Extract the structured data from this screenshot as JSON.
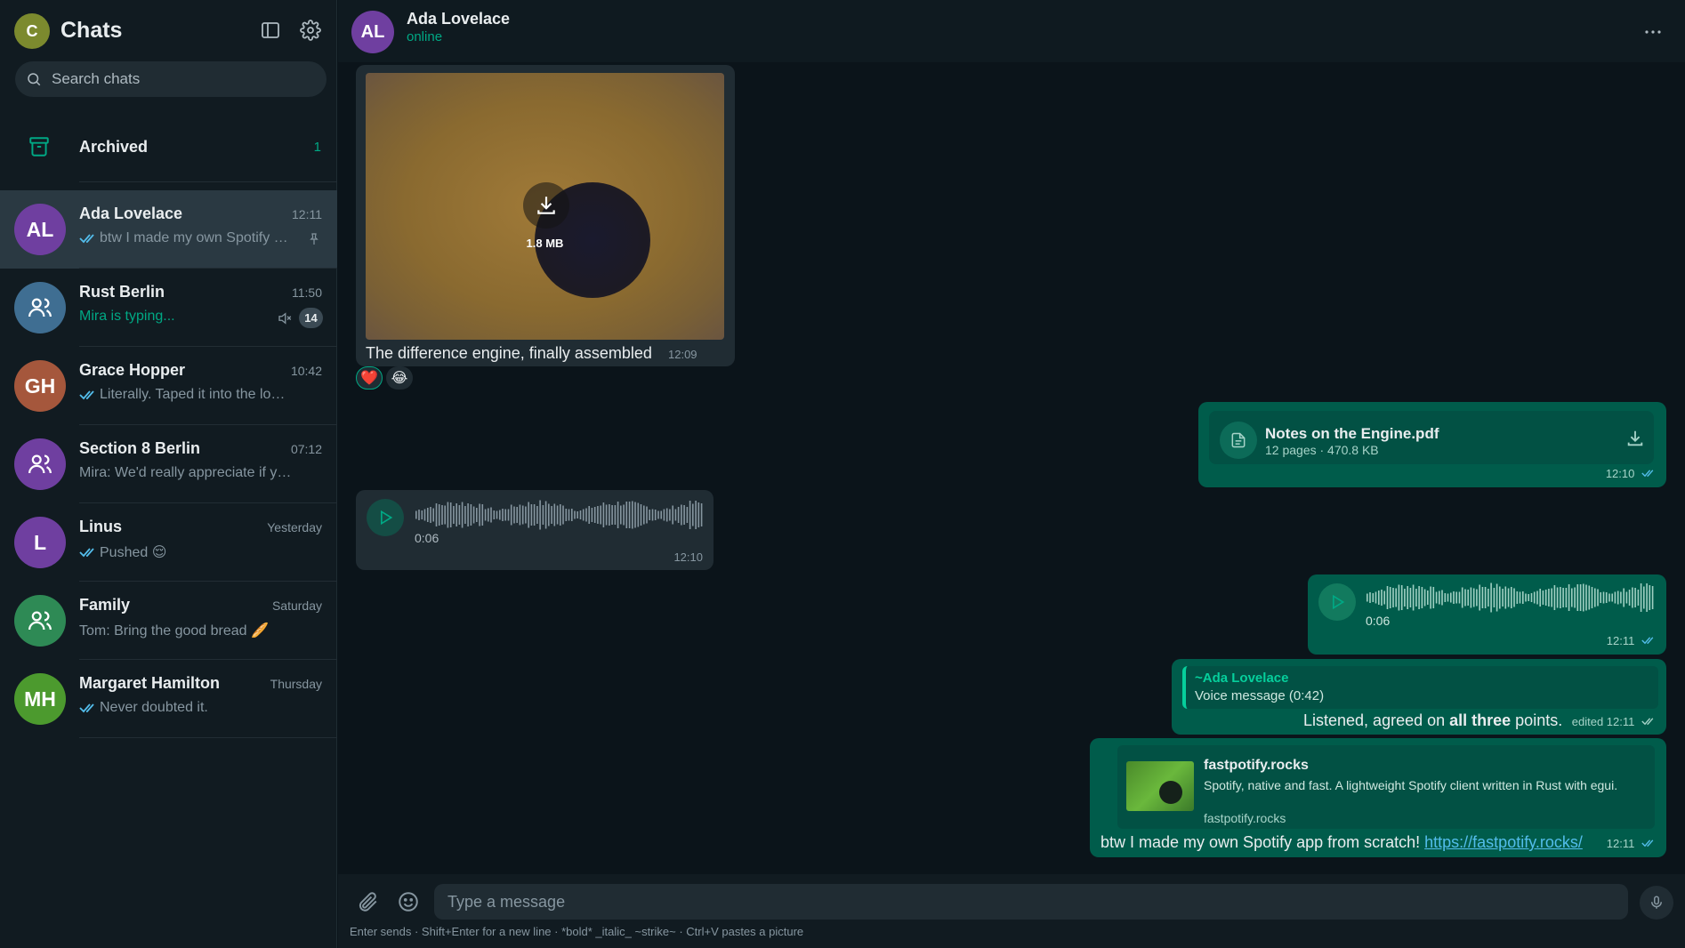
{
  "sidebar": {
    "title": "Chats",
    "me_initial": "C",
    "search_placeholder": "Search chats",
    "archived": {
      "label": "Archived",
      "count": "1"
    },
    "chats": [
      {
        "initials": "AL",
        "color": "#6f3fa0",
        "name": "Ada Lovelace",
        "time": "12:11",
        "preview": "btw I made my own Spotify a...",
        "ticks": true,
        "pinned": true,
        "group": false
      },
      {
        "initials": "",
        "color": "#3f6e92",
        "name": "Rust Berlin",
        "time": "11:50",
        "preview": "Mira is typing...",
        "typing": true,
        "muted": true,
        "unread": "14",
        "group": true
      },
      {
        "initials": "GH",
        "color": "#a5573c",
        "name": "Grace Hopper",
        "time": "10:42",
        "preview": "Literally. Taped it into the logbo...",
        "ticks": true,
        "group": false
      },
      {
        "initials": "",
        "color": "#6f3fa0",
        "name": "Section 8 Berlin",
        "time": "07:12",
        "preview": "Mira: We'd really appreciate if you c...",
        "group": true
      },
      {
        "initials": "L",
        "color": "#6f3fa0",
        "name": "Linus",
        "time": "Yesterday",
        "preview": "Pushed 😌",
        "ticks": true,
        "group": false
      },
      {
        "initials": "",
        "color": "#2e8a55",
        "name": "Family",
        "time": "Saturday",
        "preview": "Tom: Bring the good bread 🥖",
        "group": true
      },
      {
        "initials": "MH",
        "color": "#4c9a2e",
        "name": "Margaret Hamilton",
        "time": "Thursday",
        "preview": "Never doubted it.",
        "ticks": true,
        "group": false
      }
    ]
  },
  "conversation": {
    "contact_initials": "AL",
    "contact_name": "Ada Lovelace",
    "contact_status": "online",
    "messages": {
      "image": {
        "size": "1.8 MB",
        "caption": "The difference engine, finally assembled",
        "time": "12:09",
        "reactions": [
          "❤️",
          "😂"
        ]
      },
      "document": {
        "name": "Notes on the Engine.pdf",
        "info": "12 pages · 470.8 KB",
        "time": "12:10"
      },
      "voice_in": {
        "duration": "0:06",
        "time": "12:10"
      },
      "voice_out": {
        "duration": "0:06",
        "time": "12:11"
      },
      "reply": {
        "quote_author": "~Ada Lovelace",
        "quote_text": "Voice message (0:42)",
        "text_before": "Listened, agreed on ",
        "text_bold": "all three",
        "text_after": " points.",
        "edited": "edited",
        "time": "12:11"
      },
      "link": {
        "title": "fastpotify.rocks",
        "description": "Spotify, native and fast. A lightweight Spotify client written in Rust with egui.",
        "domain": "fastpotify.rocks",
        "text": "btw I made my own Spotify app from scratch! ",
        "url": "https://fastpotify.rocks/",
        "time": "12:11"
      }
    }
  },
  "composer": {
    "placeholder": "Type a message",
    "hint": "Enter sends · Shift+Enter for a new line · *bold* _italic_ ~strike~ · Ctrl+V pastes a picture"
  },
  "icons": {
    "sidebar_toggle": "sidebar-panel-icon",
    "settings": "gear-icon",
    "search": "search-icon",
    "archive": "archive-icon",
    "pin": "pin-icon",
    "mute": "muted-speaker-icon",
    "menu": "more-horizontal-icon",
    "download": "download-icon",
    "play": "play-icon",
    "document": "document-icon",
    "attach": "paperclip-icon",
    "emoji": "smiley-icon",
    "mic": "microphone-icon"
  },
  "colors": {
    "accent": "#00a884",
    "outgoing": "#005c4b",
    "incoming": "#202c33",
    "read_ticks": "#53bdeb"
  }
}
